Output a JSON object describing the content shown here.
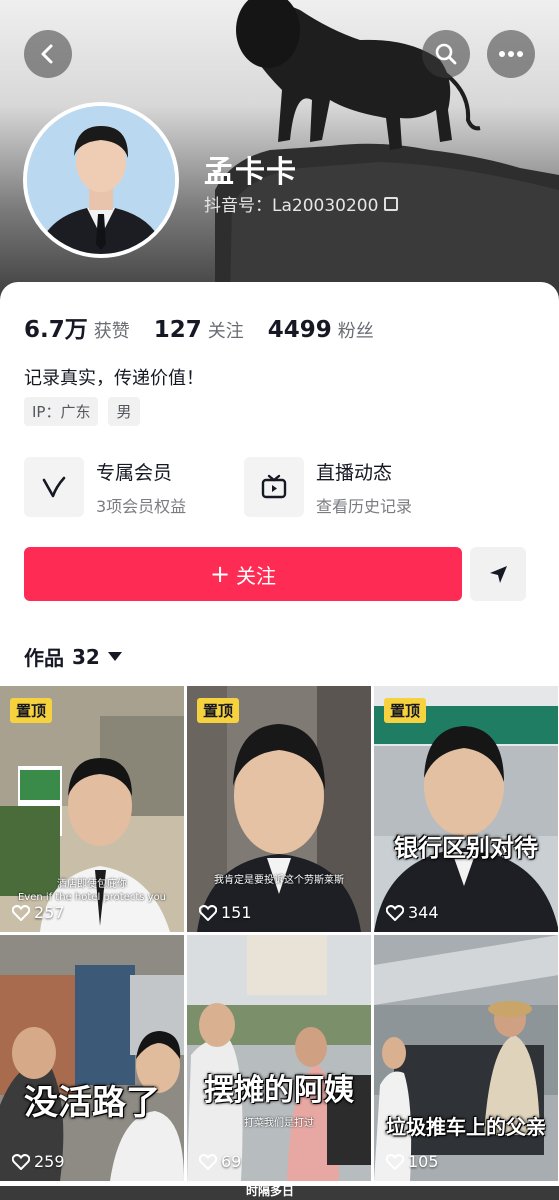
{
  "profile": {
    "nickname": "孟卡卡",
    "douyin_id": "抖音号：La20030200",
    "bio": "记录真实，传递价值！",
    "tags": [
      "IP：广东",
      "男"
    ]
  },
  "stats": [
    {
      "value": "6.7万",
      "label": "获赞"
    },
    {
      "value": "127",
      "label": "关注"
    },
    {
      "value": "4499",
      "label": "粉丝"
    }
  ],
  "features": {
    "member": {
      "title": "专属会员",
      "subtitle": "3项会员权益",
      "icon": "v-member-icon"
    },
    "live": {
      "title": "直播动态",
      "subtitle": "查看历史记录",
      "icon": "tv-play-icon"
    }
  },
  "actions": {
    "follow_label": "关注",
    "follow_plus": "+"
  },
  "works": {
    "label": "作品",
    "count": "32"
  },
  "videos": [
    {
      "pinned": "置顶",
      "likes": "257",
      "subtitle": "酒店即使包庇你\nEven if the hotel protects you",
      "title": ""
    },
    {
      "pinned": "置顶",
      "likes": "151",
      "subtitle": "我肯定是要投诉这个劳斯莱斯",
      "title": ""
    },
    {
      "pinned": "置顶",
      "likes": "344",
      "subtitle": "",
      "title": "银行区别对待"
    },
    {
      "pinned": "",
      "likes": "259",
      "subtitle": "",
      "title": "没活路了"
    },
    {
      "pinned": "",
      "likes": "69",
      "subtitle": "打菜我们是打过",
      "title": "摆摊的阿姨"
    },
    {
      "pinned": "",
      "likes": "105",
      "subtitle": "",
      "title": "垃圾推车上的父亲"
    }
  ],
  "partial_row_text": "时隔多日",
  "colors": {
    "accent": "#fe2c55",
    "pin_badge": "#f6d33e"
  }
}
